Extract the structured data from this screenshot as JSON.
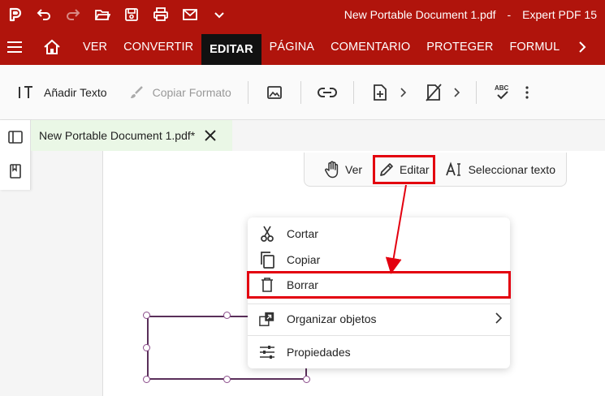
{
  "window": {
    "title": "New Portable Document 1.pdf",
    "app_name": "Expert PDF 15"
  },
  "quick_access": [
    "undo-icon",
    "redo-icon",
    "open-folder-icon",
    "save-icon",
    "print-icon",
    "mail-icon",
    "chevron-down-icon"
  ],
  "tabs": [
    {
      "label": "VER"
    },
    {
      "label": "CONVERTIR"
    },
    {
      "label": "EDITAR",
      "active": true
    },
    {
      "label": "PÁGINA"
    },
    {
      "label": "COMENTARIO"
    },
    {
      "label": "PROTEGER"
    },
    {
      "label": "FORMULARIO"
    }
  ],
  "toolbar": {
    "add_text": "Añadir Texto",
    "copy_format": "Copiar Formato",
    "spell_label": "ABC"
  },
  "document_tab": {
    "label": "New Portable Document 1.pdf*"
  },
  "mode_bar": {
    "view": "Ver",
    "edit": "Editar",
    "select_text": "Seleccionar texto"
  },
  "context_menu": {
    "cut": "Cortar",
    "copy": "Copiar",
    "delete": "Borrar",
    "arrange": "Organizar objetos",
    "properties": "Propiedades"
  },
  "colors": {
    "brand": "#b0140c",
    "active_tab": "#111111",
    "highlight": "#e3000f",
    "doc_tab_bg": "#eaf7e6"
  }
}
